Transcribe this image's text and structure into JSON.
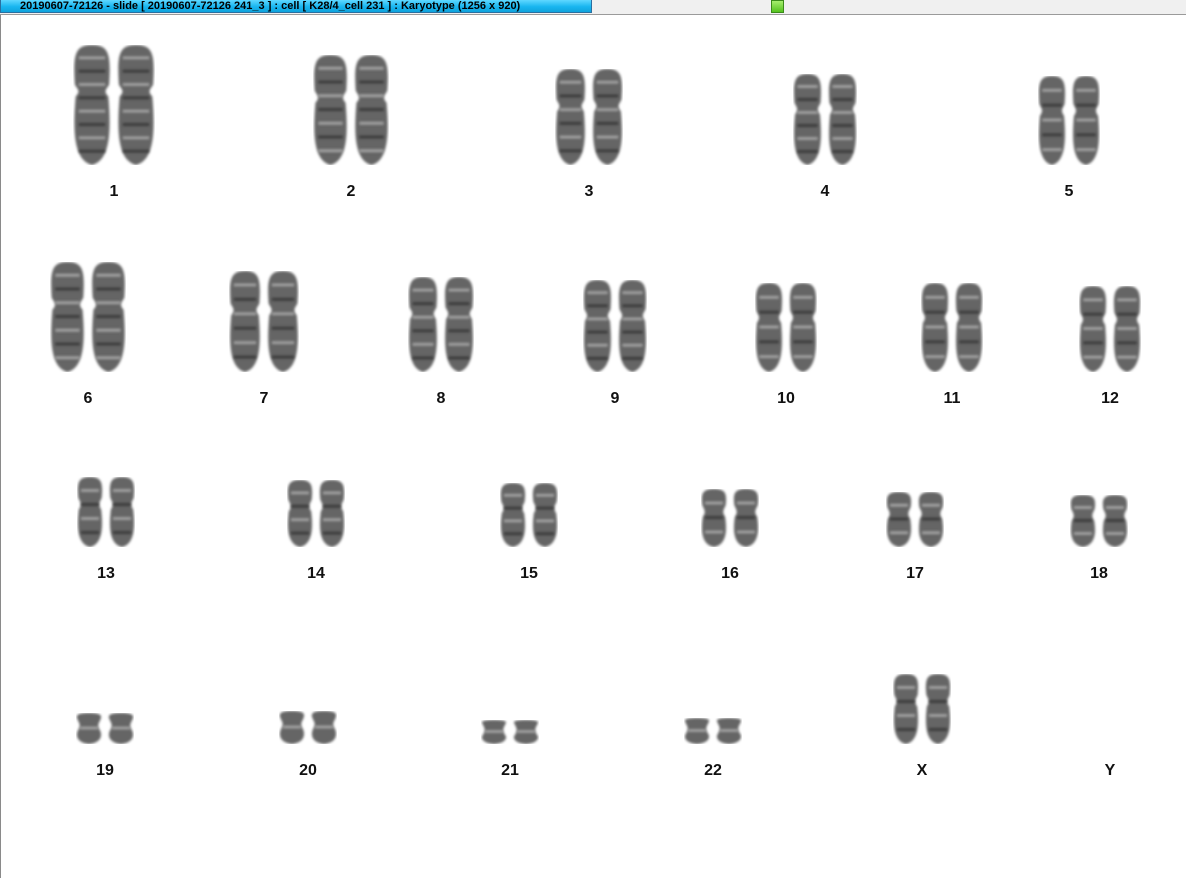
{
  "window": {
    "title": "20190607-72126 - slide [ 20190607-72126 241_3 ] : cell [ K28/4_cell 231 ] : Karyotype  (1256 x 920)"
  },
  "colors": {
    "title_tab": "#19b6f0",
    "status_indicator": "#54c21e",
    "chromosome": "#3a3a3a",
    "background": "#ffffff"
  },
  "karyotype": {
    "chromosomes": [
      {
        "label": "1",
        "size": 1.0,
        "present": 2
      },
      {
        "label": "2",
        "size": 0.92,
        "present": 2
      },
      {
        "label": "3",
        "size": 0.8,
        "present": 2
      },
      {
        "label": "4",
        "size": 0.76,
        "present": 2
      },
      {
        "label": "5",
        "size": 0.74,
        "present": 2
      },
      {
        "label": "6",
        "size": 0.72,
        "present": 2
      },
      {
        "label": "7",
        "size": 0.66,
        "present": 2
      },
      {
        "label": "8",
        "size": 0.62,
        "present": 2
      },
      {
        "label": "9",
        "size": 0.6,
        "present": 2
      },
      {
        "label": "10",
        "size": 0.58,
        "present": 2
      },
      {
        "label": "11",
        "size": 0.58,
        "present": 2
      },
      {
        "label": "12",
        "size": 0.56,
        "present": 2
      },
      {
        "label": "13",
        "size": 0.46,
        "present": 2
      },
      {
        "label": "14",
        "size": 0.44,
        "present": 2
      },
      {
        "label": "15",
        "size": 0.42,
        "present": 2
      },
      {
        "label": "16",
        "size": 0.38,
        "present": 2
      },
      {
        "label": "17",
        "size": 0.36,
        "present": 2
      },
      {
        "label": "18",
        "size": 0.34,
        "present": 2
      },
      {
        "label": "19",
        "size": 0.28,
        "present": 2
      },
      {
        "label": "20",
        "size": 0.3,
        "present": 2
      },
      {
        "label": "21",
        "size": 0.22,
        "present": 2
      },
      {
        "label": "22",
        "size": 0.24,
        "present": 2
      },
      {
        "label": "X",
        "size": 0.64,
        "present": 2
      },
      {
        "label": "Y",
        "size": 0.2,
        "present": 0
      }
    ]
  }
}
